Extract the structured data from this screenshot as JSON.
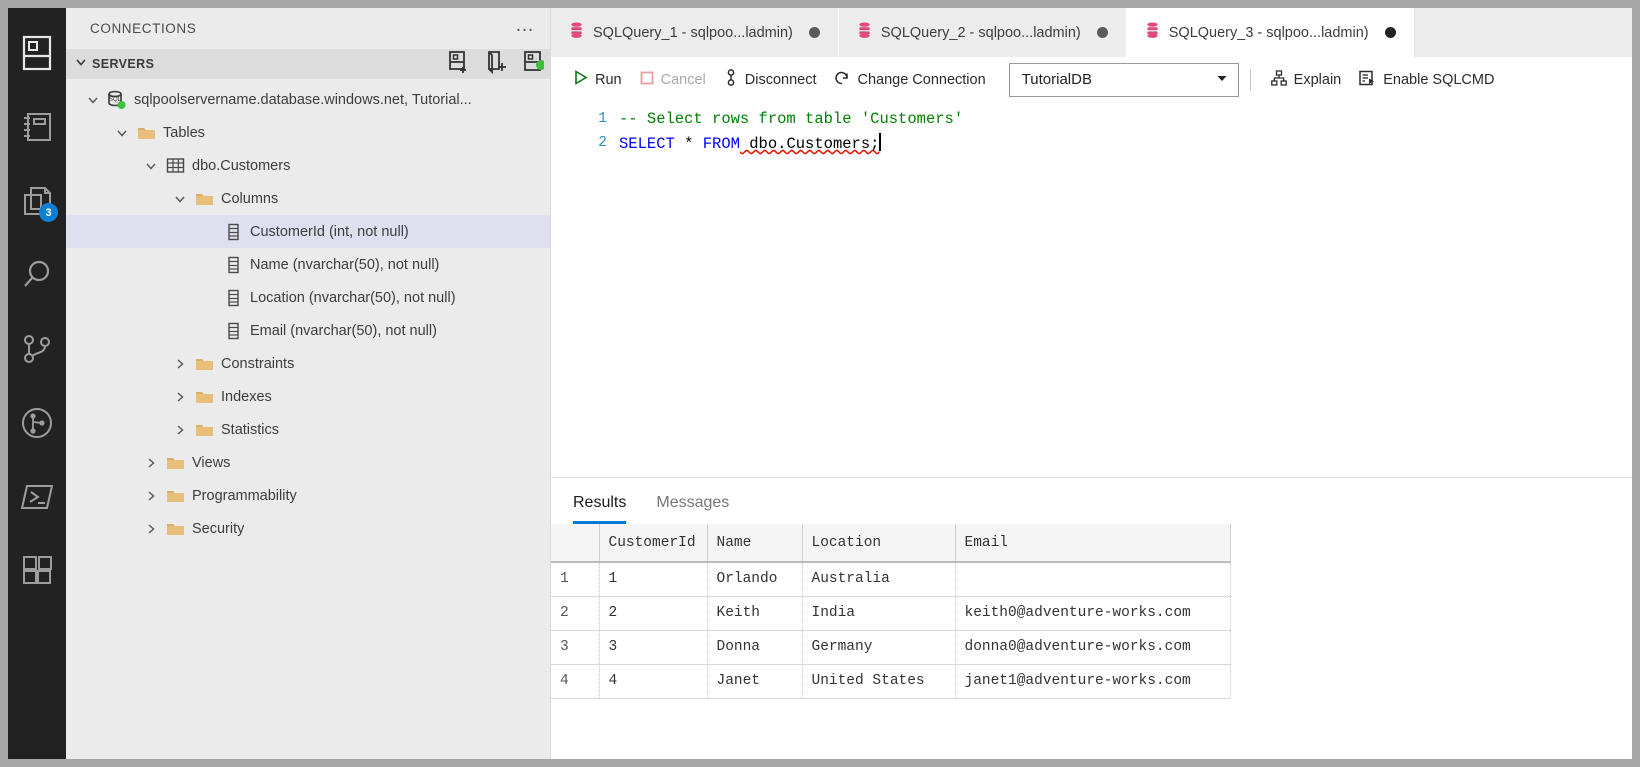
{
  "activitybar": {
    "items": [
      {
        "name": "connections-icon",
        "label": "Connections"
      },
      {
        "name": "notebooks-icon",
        "label": "Notebooks"
      },
      {
        "name": "explorer-files-icon",
        "label": "Explorer",
        "badge": "3"
      },
      {
        "name": "search-icon",
        "label": "Search"
      },
      {
        "name": "source-control-icon",
        "label": "Source Control"
      },
      {
        "name": "git-graph-icon",
        "label": "Git Graph"
      },
      {
        "name": "terminal-icon",
        "label": "Terminal"
      },
      {
        "name": "extensions-icon",
        "label": "Extensions"
      }
    ]
  },
  "sidepanel": {
    "title": "CONNECTIONS",
    "more_actions": "…",
    "section": {
      "label": "SERVERS",
      "actions": [
        {
          "name": "new-connection-icon",
          "title": "New Connection"
        },
        {
          "name": "new-server-group-icon",
          "title": "New Server Group"
        },
        {
          "name": "active-connections-icon",
          "title": "Active Connections"
        }
      ]
    },
    "tree": [
      {
        "label": "sqlpoolservername.database.windows.net, Tutorial...",
        "icon": "sql-server-icon",
        "indent": 0,
        "expanded": true,
        "selected": false
      },
      {
        "label": "Tables",
        "icon": "folder-icon",
        "indent": 1,
        "expanded": true,
        "selected": false
      },
      {
        "label": "dbo.Customers",
        "icon": "table-icon",
        "indent": 2,
        "expanded": true,
        "selected": false
      },
      {
        "label": "Columns",
        "icon": "folder-icon",
        "indent": 3,
        "expanded": true,
        "selected": false
      },
      {
        "label": "CustomerId (int, not null)",
        "icon": "column-icon",
        "indent": 4,
        "expanded": null,
        "selected": true
      },
      {
        "label": "Name (nvarchar(50), not null)",
        "icon": "column-icon",
        "indent": 4,
        "expanded": null,
        "selected": false
      },
      {
        "label": "Location (nvarchar(50), not null)",
        "icon": "column-icon",
        "indent": 4,
        "expanded": null,
        "selected": false
      },
      {
        "label": "Email (nvarchar(50), not null)",
        "icon": "column-icon",
        "indent": 4,
        "expanded": null,
        "selected": false
      },
      {
        "label": "Constraints",
        "icon": "folder-icon",
        "indent": 3,
        "expanded": false,
        "selected": false
      },
      {
        "label": "Indexes",
        "icon": "folder-icon",
        "indent": 3,
        "expanded": false,
        "selected": false
      },
      {
        "label": "Statistics",
        "icon": "folder-icon",
        "indent": 3,
        "expanded": false,
        "selected": false
      },
      {
        "label": "Views",
        "icon": "folder-icon",
        "indent": 2,
        "expanded": false,
        "selected": false
      },
      {
        "label": "Programmability",
        "icon": "folder-icon",
        "indent": 2,
        "expanded": false,
        "selected": false
      },
      {
        "label": "Security",
        "icon": "folder-icon",
        "indent": 2,
        "expanded": false,
        "selected": false
      }
    ]
  },
  "tabs": [
    {
      "label": "SQLQuery_1 - sqlpoo...ladmin)",
      "icon": "database-icon",
      "dirty": true,
      "active": false
    },
    {
      "label": "SQLQuery_2 - sqlpoo...ladmin)",
      "icon": "database-icon",
      "dirty": true,
      "active": false
    },
    {
      "label": "SQLQuery_3 - sqlpoo...ladmin)",
      "icon": "database-icon",
      "dirty": true,
      "active": true
    }
  ],
  "toolbar": {
    "run_label": "Run",
    "cancel_label": "Cancel",
    "disconnect_label": "Disconnect",
    "change_connection_label": "Change Connection",
    "database_value": "TutorialDB",
    "explain_label": "Explain",
    "enable_sqlcmd_label": "Enable SQLCMD"
  },
  "editor": {
    "lines": [
      {
        "num": "1",
        "comment": "-- Select rows from table 'Customers'"
      },
      {
        "num": "2",
        "kw1": "SELECT",
        "star": " * ",
        "kw2": "FROM",
        "obj": " dbo.Customers;"
      }
    ]
  },
  "results": {
    "tabs": [
      {
        "label": "Results",
        "active": true
      },
      {
        "label": "Messages",
        "active": false
      }
    ],
    "columns": [
      "CustomerId",
      "Name",
      "Location",
      "Email"
    ],
    "rows": [
      {
        "n": "1",
        "cells": [
          "1",
          "Orlando",
          "Australia",
          ""
        ]
      },
      {
        "n": "2",
        "cells": [
          "2",
          "Keith",
          "India",
          "keith0@adventure-works.com"
        ]
      },
      {
        "n": "3",
        "cells": [
          "3",
          "Donna",
          "Germany",
          "donna0@adventure-works.com"
        ]
      },
      {
        "n": "4",
        "cells": [
          "4",
          "Janet",
          "United States",
          "janet1@adventure-works.com"
        ]
      }
    ]
  },
  "colors": {
    "accent": "#0078d4",
    "badge": "#0f7fd4",
    "folder": "#e8bf7a",
    "db_icon": "#e0487b",
    "run_green": "#107c10",
    "cancel_red": "#e8a0a0",
    "connected_green": "#3cc03c",
    "comment_green": "#008000",
    "keyword_blue": "#0000ff",
    "error_squiggle": "#e51400"
  }
}
